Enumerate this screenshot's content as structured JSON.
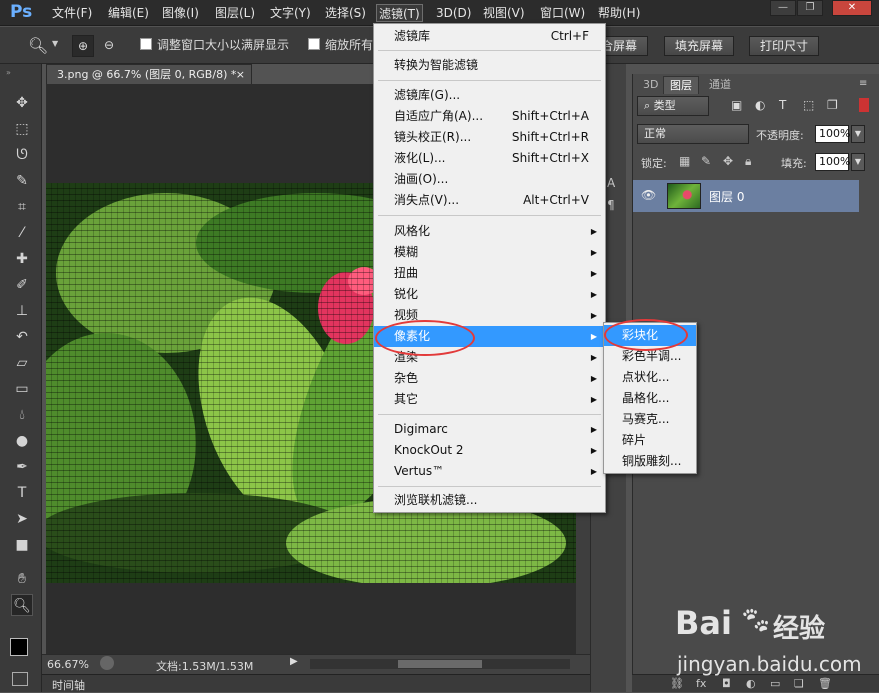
{
  "app": {
    "logo": "Ps"
  },
  "menubar": {
    "items": [
      "文件(F)",
      "编辑(E)",
      "图像(I)",
      "图层(L)",
      "文字(Y)",
      "选择(S)",
      "滤镜(T)",
      "3D(D)",
      "视图(V)",
      "窗口(W)",
      "帮助(H)"
    ],
    "active_index": 6
  },
  "options": {
    "checkbox1_label": "调整窗口大小以满屏显示",
    "checkbox2_label": "缩放所有",
    "btn_fit": "合屏幕",
    "btn_fill": "填充屏幕",
    "btn_print": "打印尺寸"
  },
  "document": {
    "tab_title": "3.png @ 66.7% (图层 0, RGB/8) *",
    "zoom": "66.67%",
    "doc_info": "文档:1.53M/1.53M",
    "timeline_label": "时间轴"
  },
  "filter_menu": {
    "items": [
      {
        "label": "滤镜库",
        "shortcut": "Ctrl+F"
      },
      {
        "label": "转换为智能滤镜",
        "shortcut": ""
      },
      {
        "label": "滤镜库(G)...",
        "shortcut": ""
      },
      {
        "label": "自适应广角(A)...",
        "shortcut": "Shift+Ctrl+A"
      },
      {
        "label": "镜头校正(R)...",
        "shortcut": "Shift+Ctrl+R"
      },
      {
        "label": "液化(L)...",
        "shortcut": "Shift+Ctrl+X"
      },
      {
        "label": "油画(O)...",
        "shortcut": ""
      },
      {
        "label": "消失点(V)...",
        "shortcut": "Alt+Ctrl+V"
      },
      {
        "label": "风格化",
        "shortcut": ""
      },
      {
        "label": "模糊",
        "shortcut": ""
      },
      {
        "label": "扭曲",
        "shortcut": ""
      },
      {
        "label": "锐化",
        "shortcut": ""
      },
      {
        "label": "视频",
        "shortcut": ""
      },
      {
        "label": "像素化",
        "shortcut": ""
      },
      {
        "label": "渲染",
        "shortcut": ""
      },
      {
        "label": "杂色",
        "shortcut": ""
      },
      {
        "label": "其它",
        "shortcut": ""
      },
      {
        "label": "Digimarc",
        "shortcut": ""
      },
      {
        "label": "KnockOut 2",
        "shortcut": ""
      },
      {
        "label": "Vertus™",
        "shortcut": ""
      },
      {
        "label": "浏览联机滤镜...",
        "shortcut": ""
      }
    ]
  },
  "pixelate_submenu": {
    "items": [
      "彩块化",
      "彩色半调...",
      "点状化...",
      "晶格化...",
      "马赛克...",
      "碎片",
      "铜版雕刻..."
    ]
  },
  "layers_panel": {
    "tabs": [
      "3D",
      "图层",
      "通道"
    ],
    "active_tab": "图层",
    "filter_type": "类型",
    "blend_mode": "正常",
    "opacity_label": "不透明度:",
    "opacity_value": "100%",
    "lock_label": "锁定:",
    "fill_label": "填充:",
    "fill_value": "100%",
    "layer_name": "图层 0"
  },
  "watermark": {
    "brand": "Bai",
    "brand2": "经验",
    "url": "jingyan.baidu.com"
  }
}
